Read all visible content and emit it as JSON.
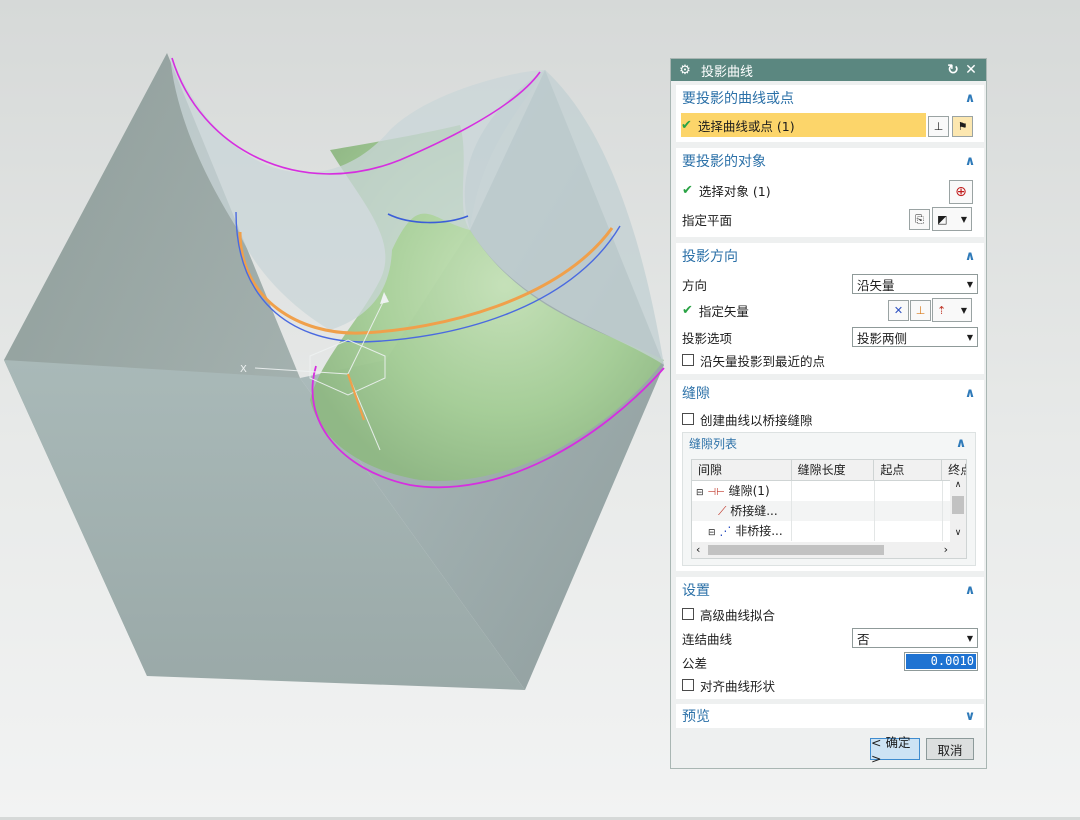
{
  "dialog": {
    "title": "投影曲线",
    "reset_icon": "reset-icon",
    "close_icon": "close-icon",
    "sections": {
      "curves": {
        "heading": "要投影的曲线或点",
        "select_label": "选择曲线或点 (1)"
      },
      "objects": {
        "heading": "要投影的对象",
        "select_label": "选择对象 (1)",
        "plane_label": "指定平面"
      },
      "direction": {
        "heading": "投影方向",
        "direction_label": "方向",
        "direction_value": "沿矢量",
        "vector_label": "指定矢量",
        "options_label": "投影选项",
        "options_value": "投影两侧",
        "nearest_label": "沿矢量投影到最近的点"
      },
      "gaps": {
        "heading": "缝隙",
        "bridge_label": "创建曲线以桥接缝隙",
        "list_heading": "缝隙列表",
        "columns": [
          "间隙",
          "缝隙长度",
          "起点",
          "终点"
        ],
        "rows": [
          "缝隙(1)",
          "桥接缝...",
          "非桥接..."
        ]
      },
      "settings": {
        "heading": "设置",
        "advanced_label": "高级曲线拟合",
        "join_label": "连结曲线",
        "join_value": "否",
        "tolerance_label": "公差",
        "tolerance_value": "0.0010",
        "align_label": "对齐曲线形状"
      },
      "preview": {
        "heading": "预览"
      }
    },
    "ok_label": "< 确定 >",
    "cancel_label": "取消"
  },
  "viewport": {
    "axis_label": "X"
  },
  "colors": {
    "title_bar": "#5b8780",
    "heading": "#2c71a8",
    "highlight": "#fcd56a",
    "check": "#2aa345"
  }
}
